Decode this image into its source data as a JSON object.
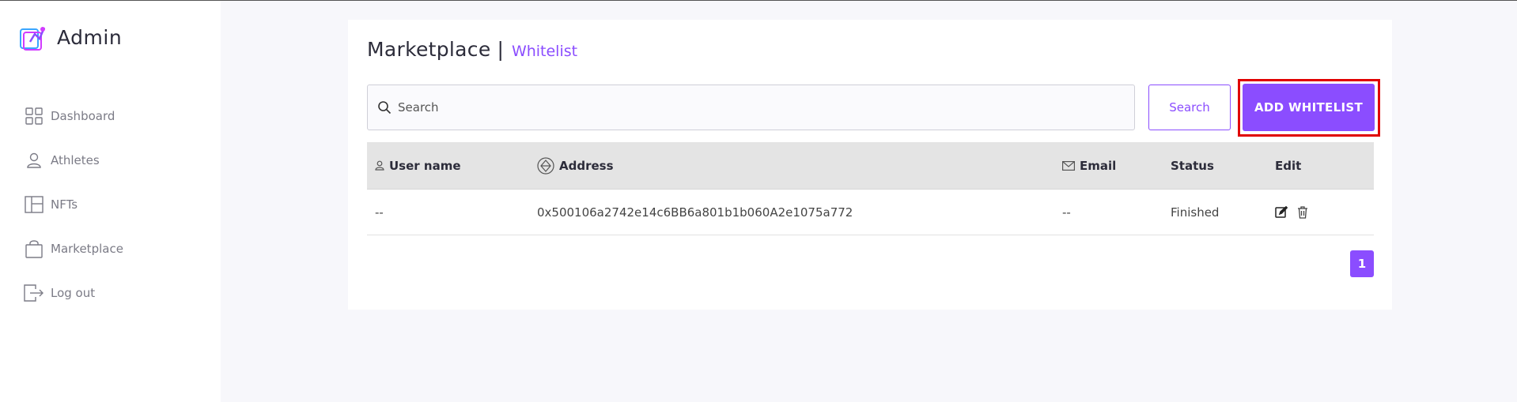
{
  "brand": {
    "name": "Admin"
  },
  "sidebar": {
    "items": [
      {
        "label": "Dashboard",
        "icon": "grid-icon"
      },
      {
        "label": "Athletes",
        "icon": "user-icon"
      },
      {
        "label": "NFTs",
        "icon": "layout-icon"
      },
      {
        "label": "Marketplace",
        "icon": "bag-icon"
      },
      {
        "label": "Log out",
        "icon": "logout-icon"
      }
    ]
  },
  "header": {
    "title": "Marketplace",
    "separator": "|",
    "subtitle": "Whitelist"
  },
  "search": {
    "placeholder": "Search",
    "value": "",
    "button_label": "Search"
  },
  "actions": {
    "add_label": "ADD WHITELIST"
  },
  "table": {
    "columns": [
      "User name",
      "Address",
      "Email",
      "Status",
      "Edit"
    ],
    "rows": [
      {
        "username": "--",
        "address": "0x500106a2742e14c6BB6a801b1b060A2e1075a772",
        "email": "--",
        "status": "Finished"
      }
    ]
  },
  "pagination": {
    "current": "1"
  },
  "colors": {
    "accent": "#8b4dff",
    "highlight": "#e00000"
  }
}
